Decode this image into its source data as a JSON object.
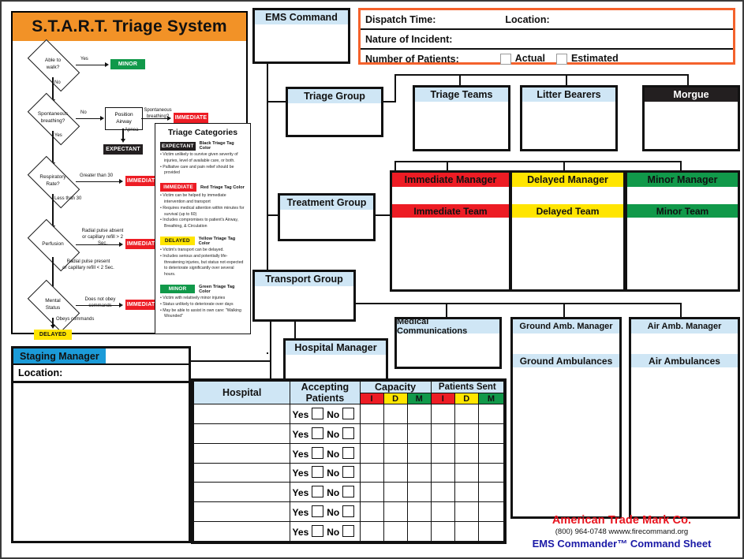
{
  "start_panel": {
    "title": "S.T.A.R.T. Triage System",
    "nodes": {
      "able_to_walk": "Able to\nwalk?",
      "spontaneous_breathing": "Spontaneous\nbreathing?",
      "position_airway": "Position\nAirway",
      "respiratory_rate": "Respiratory\nRate?",
      "perfusion": "Perfusion",
      "mental_status": "Mental\nStatus"
    },
    "edges": {
      "yes": "Yes",
      "no": "No",
      "yes2": "Yes",
      "no2": "No",
      "apnea": "Apnea",
      "spont_breathing2": "Spontaneous\nbreathing?",
      "greater_than_30": "Greater than 30",
      "less_than_30": "Less than 30",
      "pulse_absent": "Radial pulse absent\nor capillary refill > 2 Sec.",
      "pulse_present": "Radial pulse present\nor capillary refill < 2 Sec.",
      "does_not_obey": "Does not obey\ncommands",
      "obeys": "Obeys commands"
    },
    "tags": {
      "minor": "MINOR",
      "immediate": "IMMEDIATE",
      "expectant": "EXPECTANT",
      "delayed": "DELAYED"
    }
  },
  "triage_categories": {
    "title": "Triage Categories",
    "items": [
      {
        "chip": "EXPECTANT",
        "chip_color": "black",
        "tag_text": "Black Triage Tag Color",
        "bullets": [
          "Victim unlikely to survive given severity of injuries, level of available care, or both.",
          "Palliative care and pain relief should be provided"
        ]
      },
      {
        "chip": "IMMEDIATE",
        "chip_color": "red",
        "tag_text": "Red Triage Tag Color",
        "bullets": [
          "Victim can be helped by immediate intervention and transport",
          "Requires medical attention within minutes for survival (up to 60)",
          "Includes compromises to patient's Airway, Breathing, & Circulation"
        ]
      },
      {
        "chip": "DELAYED",
        "chip_color": "yellow",
        "tag_text": "Yellow Triage Tag Color",
        "bullets": [
          "Victim's transport can be delayed.",
          "Includes serious and potentially life-threatening injuries, but status not expected to deteriorate significantly over several hours."
        ]
      },
      {
        "chip": "MINOR",
        "chip_color": "green",
        "tag_text": "Green Triage Tag Color",
        "bullets": [
          "Victim with relatively minor injuries",
          "Status unlikely to deteriorate over days",
          "May be able to assist in own care: \"Walking Wounded\""
        ]
      }
    ]
  },
  "dispatch": {
    "dispatch_time_label": "Dispatch Time:",
    "location_label": "Location:",
    "nature_label": "Nature of Incident:",
    "patients_label": "Number of Patients:",
    "actual_label": "Actual",
    "estimated_label": "Estimated",
    "border_color": "#f4622c"
  },
  "org": {
    "ems_command": "EMS Command",
    "triage_group": "Triage Group",
    "treatment_group": "Treatment Group",
    "transport_group": "Transport Group",
    "triage_teams": "Triage Teams",
    "litter_bearers": "Litter Bearers",
    "morgue": "Morgue",
    "immediate_manager": "Immediate Manager",
    "immediate_team": "Immediate Team",
    "delayed_manager": "Delayed Manager",
    "delayed_team": "Delayed Team",
    "minor_manager": "Minor Manager",
    "minor_team": "Minor Team",
    "medical_communications": "Medical Communications",
    "hospital_manager": "Hospital Manager",
    "ground_amb_manager": "Ground Amb. Manager",
    "ground_ambulances": "Ground Ambulances",
    "air_amb_manager": "Air Amb. Manager",
    "air_ambulances": "Air Ambulances",
    "colors": {
      "header_blue": "#cfe6f5",
      "immediate_red": "#ed1c24",
      "delayed_yellow": "#ffe500",
      "minor_green": "#11994a",
      "morgue_black": "#231f20"
    }
  },
  "staging": {
    "title": "Staging Manager",
    "location_label": "Location:",
    "accent_color": "#1b9bd8"
  },
  "hospital_table": {
    "columns": {
      "hospital": "Hospital",
      "accepting_patients": "Accepting Patients",
      "capacity": "Capacity",
      "patients_sent": "Patients Sent"
    },
    "sub_columns": [
      "I",
      "D",
      "M"
    ],
    "yes_label": "Yes",
    "no_label": "No",
    "row_count": 7
  },
  "branding": {
    "company": "American Trade Mark Co.",
    "contact": "(800) 964-0748    wwww.firecommand.org",
    "product": "EMS Commander™ Command Sheet",
    "company_color": "#e8151f",
    "product_color": "#1a19a6"
  }
}
